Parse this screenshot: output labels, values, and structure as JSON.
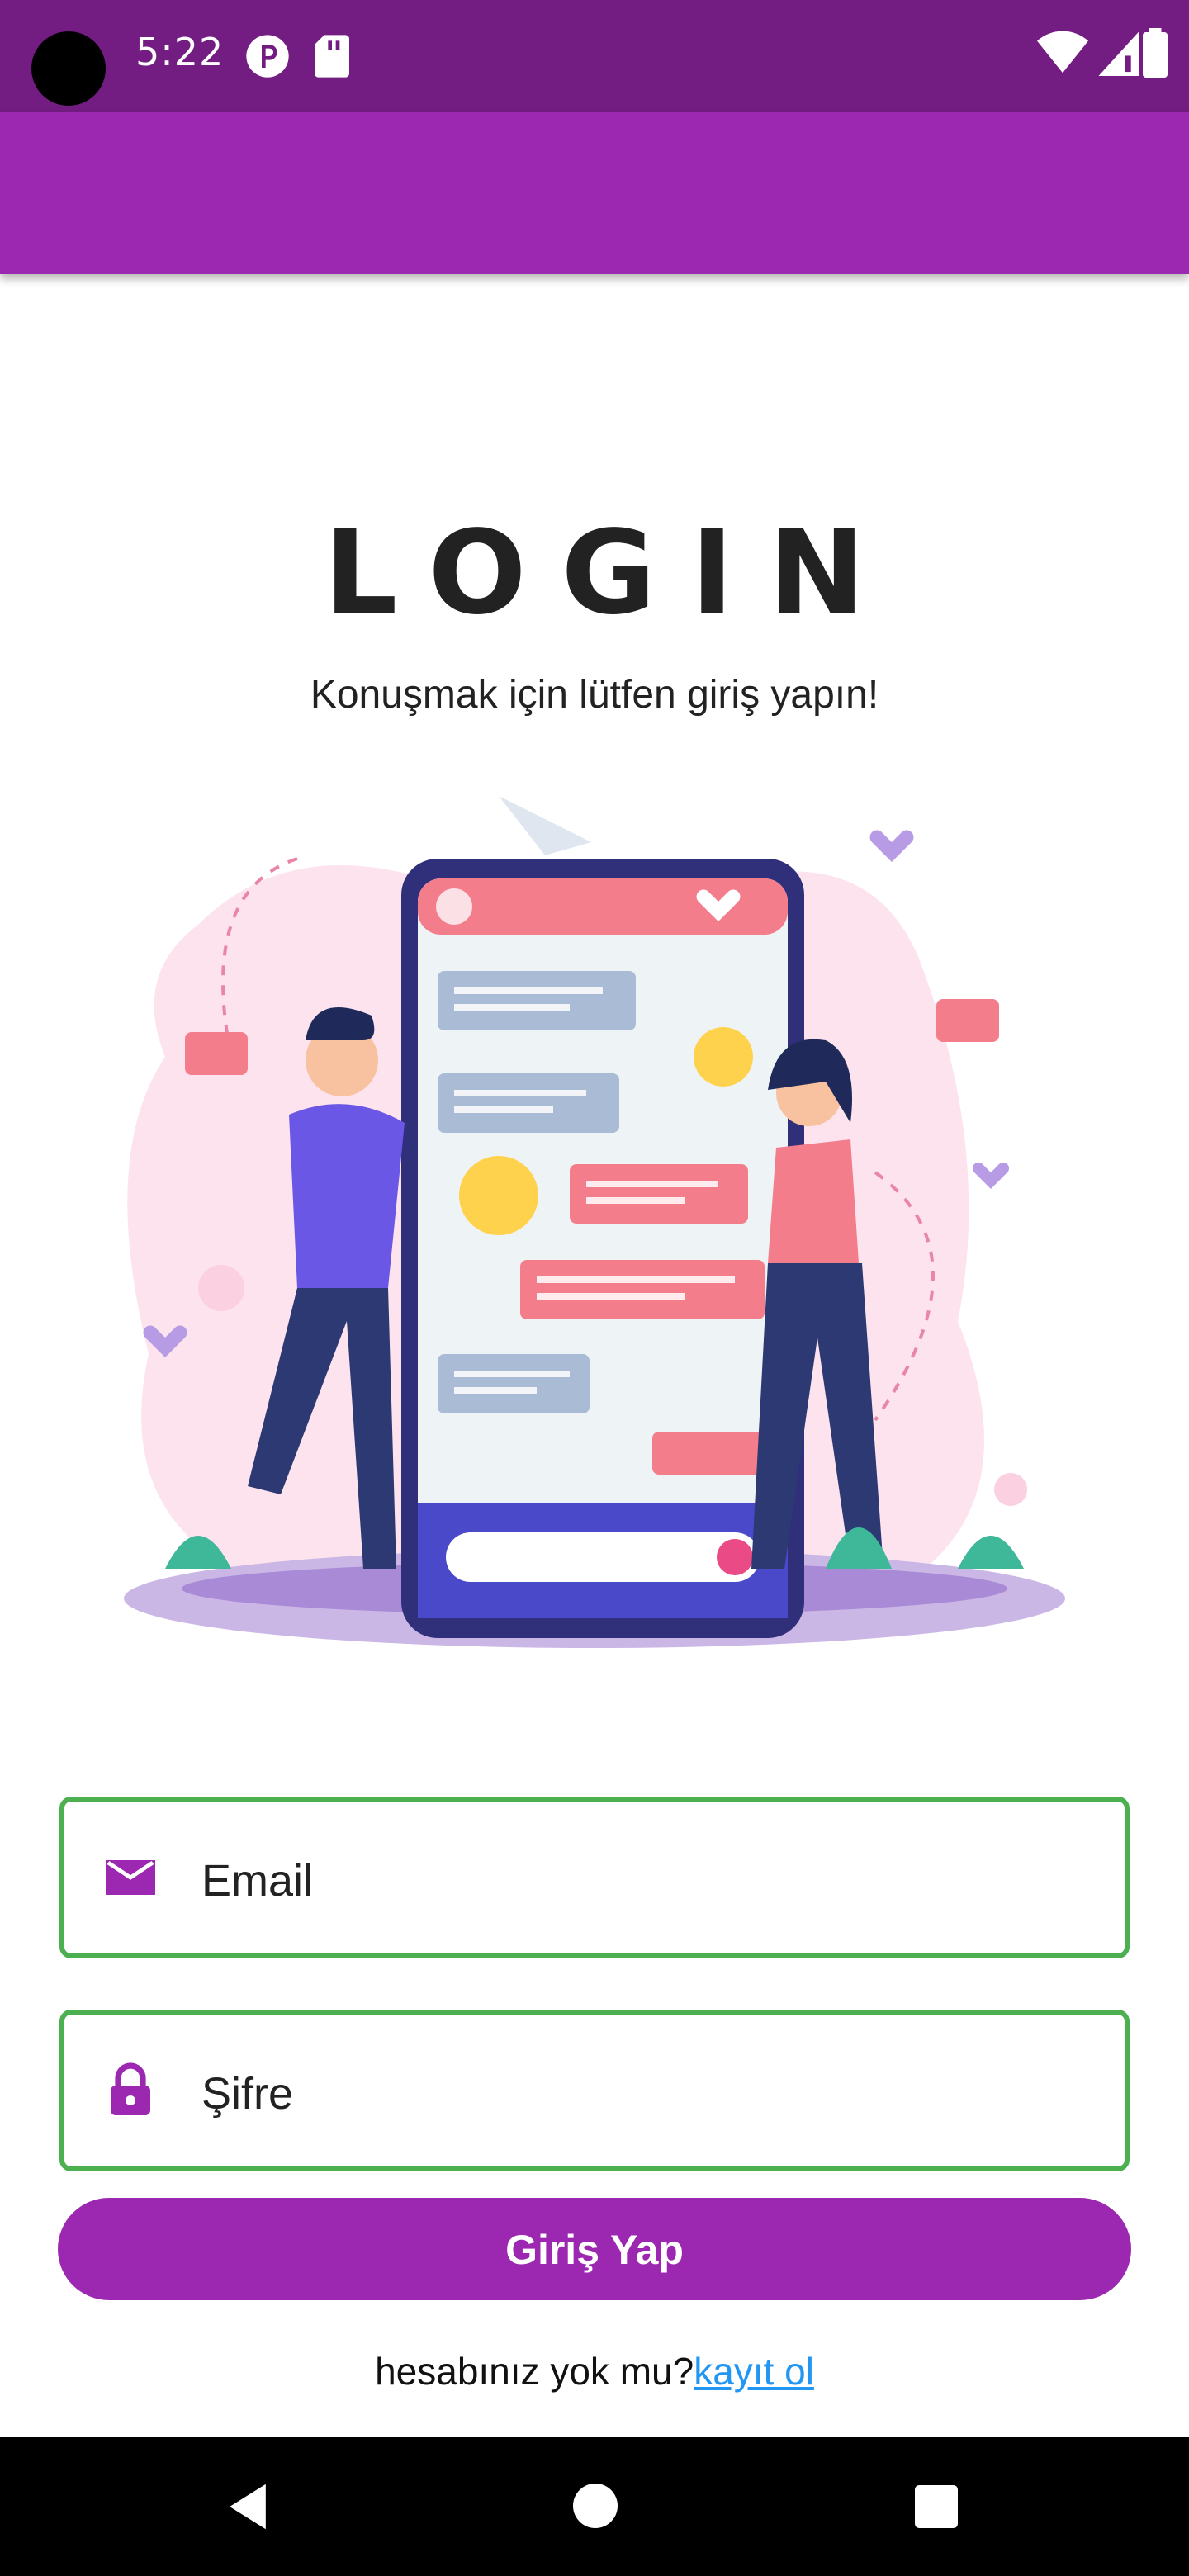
{
  "status_bar": {
    "time": "5:22",
    "icons": [
      "camera-hole",
      "notification-p-icon",
      "sd-card-icon",
      "wifi-icon",
      "signal-icon",
      "battery-icon"
    ],
    "color": "#731c82"
  },
  "app_bar": {
    "color": "#9c27b0"
  },
  "page": {
    "title": "LOGIN",
    "subtitle": "Konuşmak için lütfen giriş yapın!"
  },
  "illustration": {
    "icon": "chat-app-illustration"
  },
  "form": {
    "email": {
      "label": "Email",
      "icon": "email-icon"
    },
    "password": {
      "label": "Şifre",
      "icon": "lock-icon"
    },
    "border_color": "#4caf50",
    "submit_label": "Giriş Yap"
  },
  "footer": {
    "prompt": "hesabınız yok mu?",
    "link": "kayıt ol"
  },
  "nav_bar": {
    "icons": [
      "back-icon",
      "home-icon",
      "recents-icon"
    ]
  }
}
